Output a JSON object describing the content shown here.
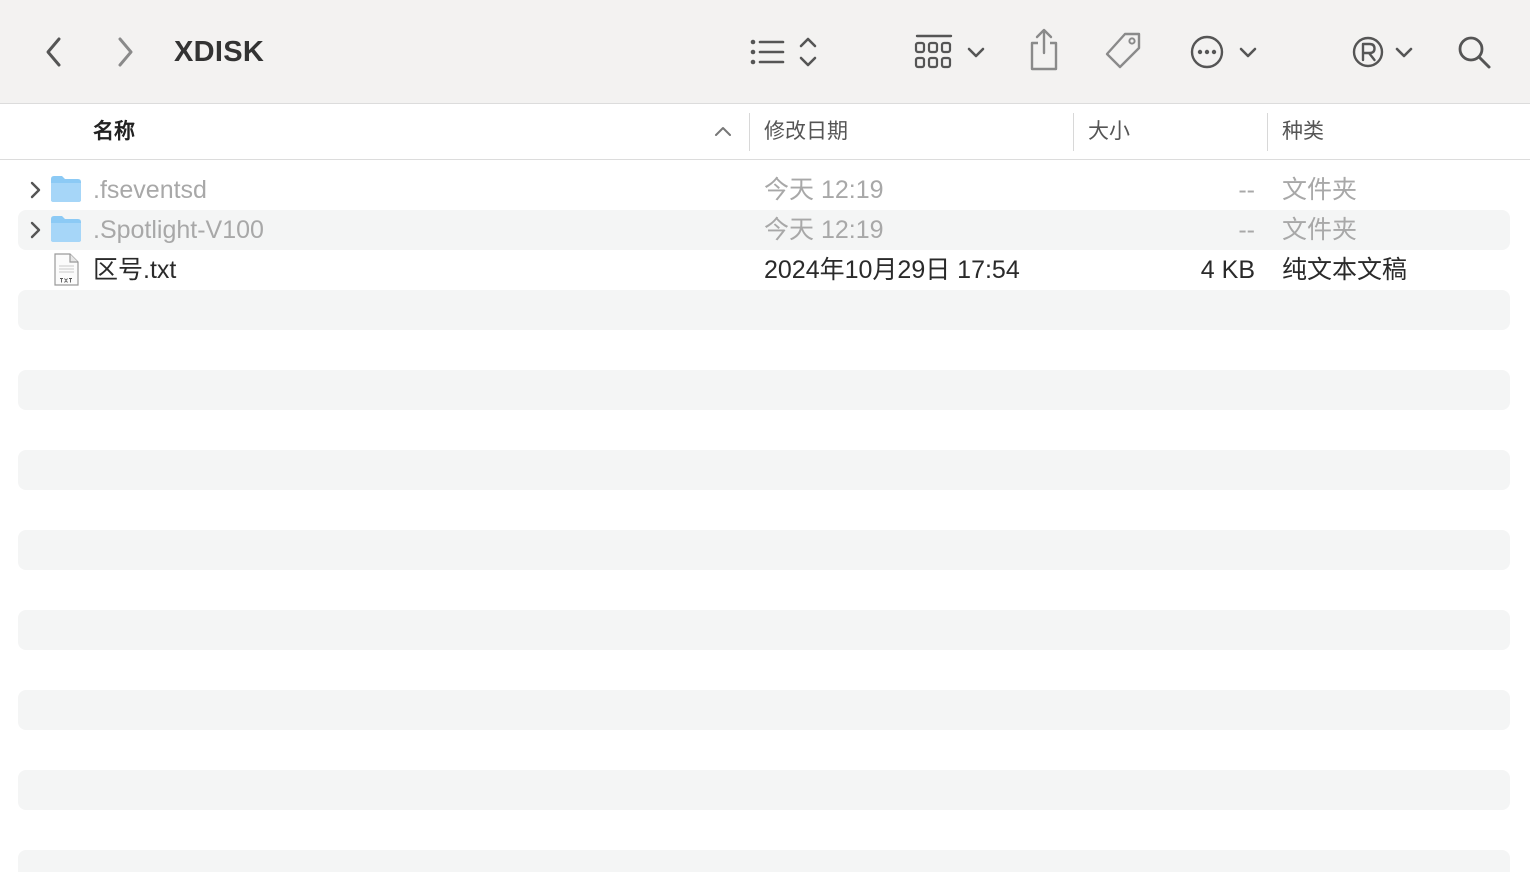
{
  "window": {
    "title": "XDISK"
  },
  "toolbar": {
    "back_icon": "chevron-left-icon",
    "forward_icon": "chevron-right-icon",
    "view_icon": "list-view-icon",
    "group_icon": "grid-group-icon",
    "share_icon": "share-icon",
    "tag_icon": "tag-icon",
    "more_icon": "ellipsis-circle-icon",
    "registered_icon": "registered-icon",
    "search_icon": "search-icon"
  },
  "columns": {
    "name": "名称",
    "date": "修改日期",
    "size": "大小",
    "kind": "种类"
  },
  "files": [
    {
      "name": ".fseventsd",
      "date": "今天 12:19",
      "size": "--",
      "kind": "文件夹",
      "icon": "folder-icon"
    },
    {
      "name": ".Spotlight-V100",
      "date": "今天 12:19",
      "size": "--",
      "kind": "文件夹",
      "icon": "folder-icon"
    },
    {
      "name": "区号.txt",
      "date": "2024年10月29日 17:54",
      "size": "4 KB",
      "kind": "纯文本文稿",
      "icon": "text-file-icon"
    }
  ],
  "colors": {
    "toolbar_bg": "#f3f2f1",
    "stripe": "#f4f5f5",
    "folder": "#8ccaf5",
    "dim_text": "#a8a8a8"
  }
}
